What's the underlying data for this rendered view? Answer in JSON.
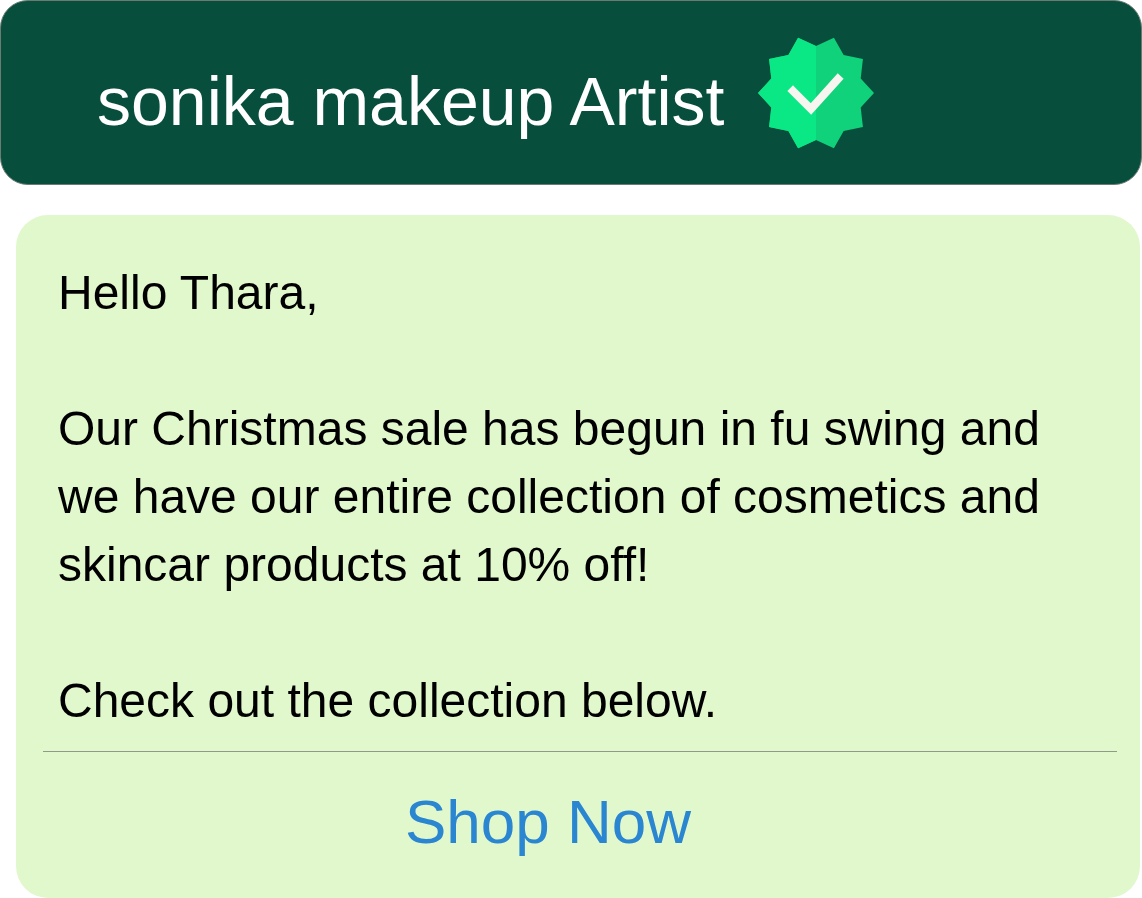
{
  "header": {
    "title": "sonika makeup Artist",
    "verified": true
  },
  "message": {
    "paragraphs": [
      "Hello Thara,",
      "Our Christmas sale has begun in fu swing and we have our entire collection of cosmetics and skincar products at 10% off!",
      "Check out the collection below."
    ]
  },
  "action": {
    "label": "Shop Now"
  }
}
